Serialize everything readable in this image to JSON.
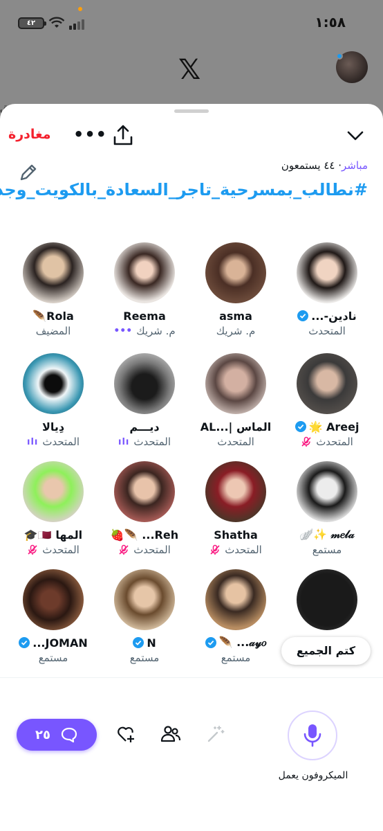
{
  "status_bar": {
    "time": "١:٥٨",
    "battery": "٤٢"
  },
  "background": {
    "app_logo": "𝕏",
    "peek_text": "تق"
  },
  "header": {
    "leave_label": "مغادرة",
    "more_label": "•••",
    "share_icon": "share-icon",
    "collapse_icon": "chevron-down-icon"
  },
  "space": {
    "live_label": "مباشر",
    "listeners": "· ٤٤ يستمعون",
    "title": "#نطالب_بمسرحية_تاجر_السعادة_بالكويت_وجدة"
  },
  "participants": [
    {
      "name": "Rola🪶",
      "role": "المضيف"
    },
    {
      "name": "Reema",
      "role": "م. شريك",
      "partner_dots": "•••"
    },
    {
      "name": "asma",
      "role": "م. شريك"
    },
    {
      "name": "نادين-...",
      "role": "المتحدث",
      "verified": true
    },
    {
      "name": "دِيالا",
      "role": "المتحدث",
      "wave": "ılı"
    },
    {
      "name": "ديـــم",
      "role": "المتحدث",
      "wave": "ılı"
    },
    {
      "name": "الماس |...AL",
      "role": "المتحدث"
    },
    {
      "name": "Areej 🌟",
      "role": "المتحدث",
      "verified": true,
      "muted": true
    },
    {
      "name": "المها 🇶🇦🎓",
      "role": "المتحدث",
      "muted": true
    },
    {
      "name": "Reh... 🪶🍓",
      "role": "المتحدث",
      "muted": true
    },
    {
      "name": "Shatha",
      "role": "المتحدث",
      "muted": true
    },
    {
      "name": "𝓂𝑒𝓁𝒶 ✨🪽",
      "role": "مستمع"
    },
    {
      "name": "JOMAN...",
      "role": "مستمع",
      "verified": true
    },
    {
      "name": "N",
      "role": "مستمع",
      "verified": true
    },
    {
      "name": "𝒶𝓎𝑜... 🪶",
      "role": "مستمع",
      "verified": true
    },
    {
      "name": "",
      "role": ""
    }
  ],
  "mute_all_label": "كتم الجميع",
  "bottom": {
    "comments_count": "٢٥",
    "mic_label": "الميكروفون يعمل"
  },
  "colors": {
    "accent_purple": "#7856ff",
    "link_blue": "#1d9bf0",
    "leave_red": "#f4212e",
    "mute_pink": "#f91880"
  }
}
